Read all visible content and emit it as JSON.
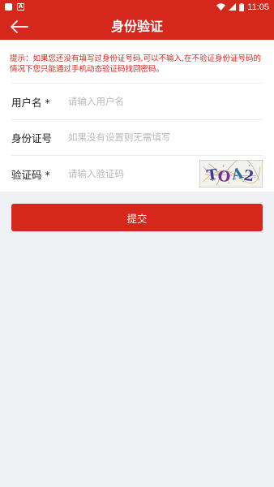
{
  "status_bar": {
    "time": "11:05",
    "icons": [
      "app-square-icon",
      "a-badge-icon",
      "wifi-icon",
      "signal-icon",
      "battery-icon"
    ]
  },
  "header": {
    "title": "身份验证",
    "back_icon": "arrow-left-icon"
  },
  "hint": {
    "text": "提示：如果您还没有填写过身份证号码,可以不输入,在不验证身份证号码的情况下您只能通过手机动态验证码找回密码。"
  },
  "form": {
    "username": {
      "label": "用户名 *",
      "placeholder": "请输入用户名",
      "value": ""
    },
    "id_number": {
      "label": "身份证号",
      "placeholder": "如果没有设置则无需填写",
      "value": ""
    },
    "captcha": {
      "label": "验证码 *",
      "placeholder": "请输入验证码",
      "value": "",
      "image_text": "TOA2"
    }
  },
  "submit": {
    "label": "提交"
  },
  "colors": {
    "primary": "#d6271c",
    "background": "#eef0f3",
    "card": "#ffffff",
    "placeholder": "#b9b9b9"
  }
}
